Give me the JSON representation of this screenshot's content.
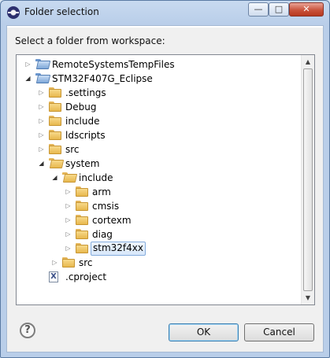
{
  "window": {
    "title": "Folder selection",
    "icon": "eclipse-icon",
    "controls": {
      "minimize": "—",
      "maximize": "□",
      "close": "✕"
    }
  },
  "prompt": "Select a folder from workspace:",
  "tree": {
    "items": [
      {
        "label": "RemoteSystemsTempFiles",
        "arrow": "collapsed",
        "icon": "project-folder-icon"
      },
      {
        "label": "STM32F407G_Eclipse",
        "arrow": "expanded",
        "icon": "project-folder-icon"
      },
      {
        "label": ".settings",
        "arrow": "collapsed",
        "icon": "folder-icon"
      },
      {
        "label": "Debug",
        "arrow": "collapsed",
        "icon": "folder-icon"
      },
      {
        "label": "include",
        "arrow": "collapsed",
        "icon": "folder-icon"
      },
      {
        "label": "ldscripts",
        "arrow": "collapsed",
        "icon": "folder-icon"
      },
      {
        "label": "src",
        "arrow": "collapsed",
        "icon": "folder-icon"
      },
      {
        "label": "system",
        "arrow": "expanded",
        "icon": "open-folder-icon"
      },
      {
        "label": "include",
        "arrow": "expanded",
        "icon": "open-folder-icon"
      },
      {
        "label": "arm",
        "arrow": "collapsed",
        "icon": "folder-icon"
      },
      {
        "label": "cmsis",
        "arrow": "collapsed",
        "icon": "folder-icon"
      },
      {
        "label": "cortexm",
        "arrow": "collapsed",
        "icon": "folder-icon"
      },
      {
        "label": "diag",
        "arrow": "collapsed",
        "icon": "folder-icon"
      },
      {
        "label": "stm32f4xx",
        "arrow": "collapsed",
        "icon": "folder-icon",
        "selected": true
      },
      {
        "label": "src",
        "arrow": "collapsed",
        "icon": "folder-icon"
      },
      {
        "label": ".cproject",
        "arrow": "none",
        "icon": "xml-file-icon"
      }
    ],
    "file_icon_glyph": "X"
  },
  "help_glyph": "?",
  "buttons": {
    "ok": "OK",
    "cancel": "Cancel"
  },
  "colors": {
    "accent": "#3c7fb1",
    "selection": "#d7e7fa"
  }
}
